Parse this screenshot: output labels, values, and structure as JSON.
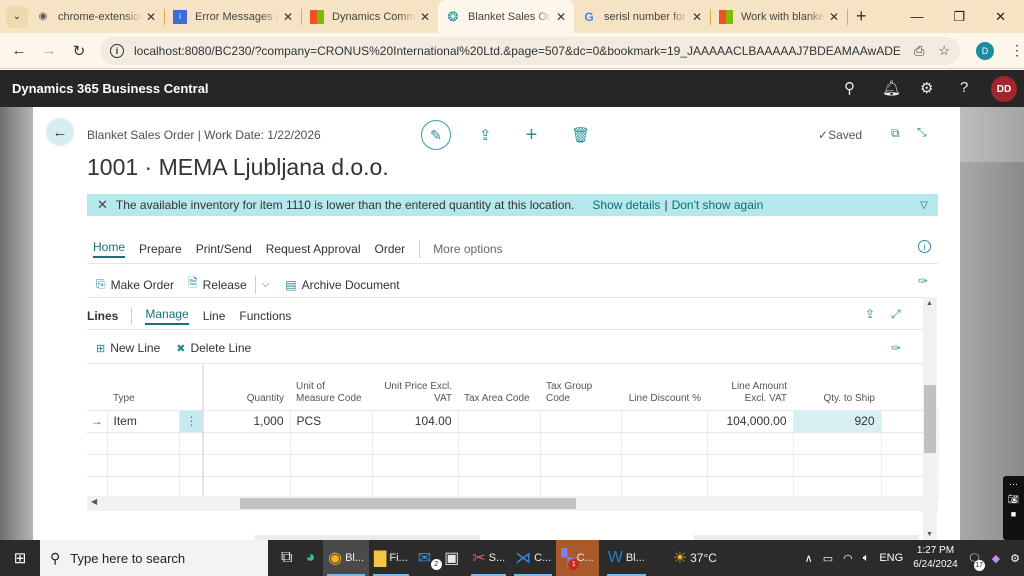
{
  "browser": {
    "tabs": [
      {
        "label": "chrome-extension_",
        "icon": "globe-icon",
        "active": false
      },
      {
        "label": "Error Messages (SA",
        "icon": "doc-icon",
        "active": false
      },
      {
        "label": "Dynamics Commun",
        "icon": "microsoft-icon",
        "active": false
      },
      {
        "label": "Blanket Sales Orde",
        "icon": "bc-icon",
        "active": true
      },
      {
        "label": "serisl number for it",
        "icon": "google-icon",
        "active": false
      },
      {
        "label": "Work with blanket",
        "icon": "microsoft-icon",
        "active": false
      }
    ],
    "url": "localhost:8080/BC230/?company=CRONUS%20International%20Ltd.&page=507&dc=0&bookmark=19_JAAAAACLBAAAAAJ7BDEAMAAwADE",
    "profile_initial": "D"
  },
  "app": {
    "title": "Dynamics 365 Business Central",
    "user_initials": "DD",
    "accent": "#2a8a94"
  },
  "page": {
    "breadcrumb": "Blanket Sales Order | Work Date: 1/22/2026",
    "title": "1001 · MEMA Ljubljana d.o.o.",
    "saved_status": "Saved",
    "notification": {
      "message": "The available inventory for item 1110 is lower than the entered quantity at this location.",
      "show_details": "Show details",
      "separator": "|",
      "dont_show": "Don't show again"
    },
    "action_tabs": [
      "Home",
      "Prepare",
      "Print/Send",
      "Request Approval",
      "Order"
    ],
    "more_options": "More options",
    "actions": {
      "make_order": "Make Order",
      "release": "Release",
      "archive": "Archive Document"
    }
  },
  "lines": {
    "title": "Lines",
    "tabs": [
      "Manage",
      "Line",
      "Functions"
    ],
    "actions": {
      "new_line": "New Line",
      "delete_line": "Delete Line"
    },
    "columns": [
      {
        "key": "type",
        "label": "Type"
      },
      {
        "key": "quantity",
        "label": "Quantity"
      },
      {
        "key": "uom",
        "label": "Unit of Measure Code"
      },
      {
        "key": "unit_price",
        "label": "Unit Price Excl. VAT"
      },
      {
        "key": "tax_area",
        "label": "Tax Area Code"
      },
      {
        "key": "tax_group",
        "label": "Tax Group Code"
      },
      {
        "key": "line_discount",
        "label": "Line Discount %"
      },
      {
        "key": "line_amount",
        "label": "Line Amount Excl. VAT"
      },
      {
        "key": "qty_to_ship",
        "label": "Qty. to Ship"
      }
    ],
    "rows": [
      {
        "type": "Item",
        "quantity": "1,000",
        "uom": "PCS",
        "unit_price": "104.00",
        "tax_area": "",
        "tax_group": "",
        "line_discount": "",
        "line_amount": "104,000.00",
        "qty_to_ship": "920"
      }
    ]
  },
  "taskbar": {
    "search_placeholder": "Type here to search",
    "apps": [
      {
        "label": "",
        "icon": "task-view-icon"
      },
      {
        "label": "",
        "icon": "edge-icon"
      },
      {
        "label": "Bl...",
        "icon": "chrome-icon"
      },
      {
        "label": "Fi...",
        "icon": "file-explorer-icon"
      },
      {
        "label": "",
        "icon": "mail-icon",
        "badge": "2"
      },
      {
        "label": "",
        "icon": "store-icon"
      },
      {
        "label": "S...",
        "icon": "snipping-icon"
      },
      {
        "label": "C...",
        "icon": "vscode-icon"
      },
      {
        "label": "C...",
        "icon": "teams-icon",
        "badge": "1"
      },
      {
        "label": "Bl...",
        "icon": "word-icon"
      }
    ],
    "weather": "37°C",
    "language": "ENG",
    "time": "1:27 PM",
    "date": "6/24/2024",
    "notifications": "17"
  }
}
